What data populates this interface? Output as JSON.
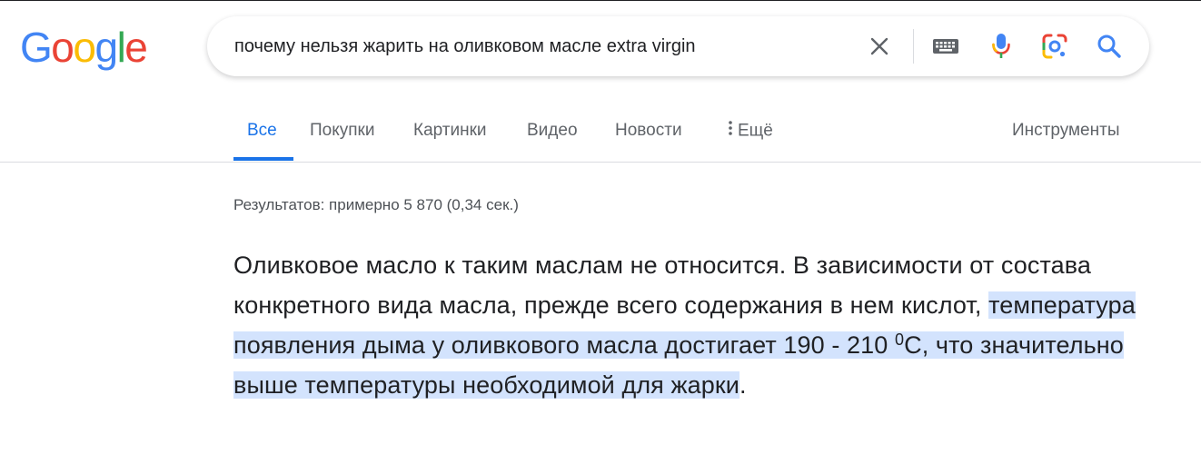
{
  "logo": {
    "letters": [
      "G",
      "o",
      "o",
      "g",
      "l",
      "e"
    ],
    "colors": [
      "#4285F4",
      "#EA4335",
      "#FBBC05",
      "#4285F4",
      "#34A853",
      "#EA4335"
    ]
  },
  "search": {
    "query": "почему нельзя жарить на оливковом масле extra virgin",
    "icons": [
      "close-icon",
      "keyboard-icon",
      "microphone-icon",
      "google-lens-icon",
      "search-icon"
    ]
  },
  "tabs": {
    "items": [
      {
        "label": "Все",
        "active": true
      },
      {
        "label": "Покупки",
        "active": false
      },
      {
        "label": "Картинки",
        "active": false
      },
      {
        "label": "Видео",
        "active": false
      },
      {
        "label": "Новости",
        "active": false
      },
      {
        "label": "Ещё",
        "active": false
      }
    ],
    "tools_label": "Инструменты"
  },
  "results": {
    "stats": "Результатов: примерно 5 870 (0,34 сек.)",
    "snippet": {
      "plain": "Оливковое масло к таким маслам не относится. В зависимости от состава конкретного вида масла, прежде всего содержания в нем кислот, ",
      "highlight_1": "температура появления дыма у оливкового масла достигает 190 - 210 ",
      "superscript": "0",
      "highlight_2": "С, что значительно выше температуры необходимой для жарки",
      "end": "."
    }
  },
  "colors": {
    "accent": "#1a73e8",
    "highlight": "#d3e3fd"
  }
}
